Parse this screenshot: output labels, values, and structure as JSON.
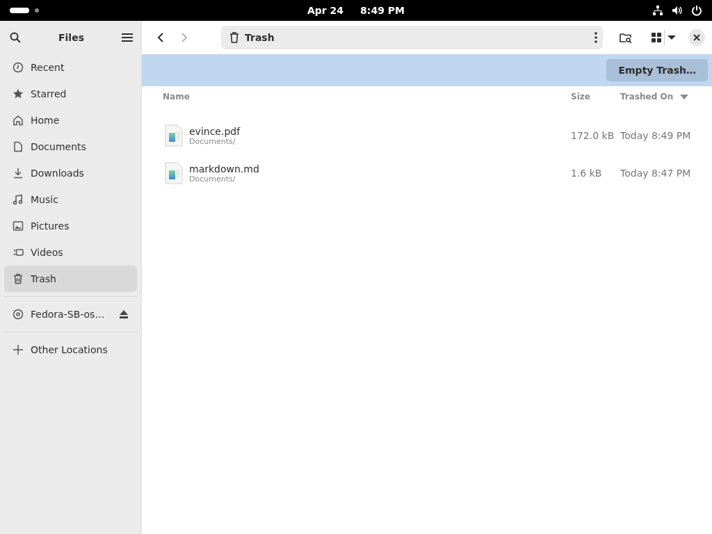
{
  "top_bar": {
    "date": "Apr 24",
    "time": "8:49 PM"
  },
  "sidebar": {
    "title": "Files",
    "places": [
      {
        "label": "Recent",
        "selected": false
      },
      {
        "label": "Starred",
        "selected": false
      },
      {
        "label": "Home",
        "selected": false
      },
      {
        "label": "Documents",
        "selected": false
      },
      {
        "label": "Downloads",
        "selected": false
      },
      {
        "label": "Music",
        "selected": false
      },
      {
        "label": "Pictures",
        "selected": false
      },
      {
        "label": "Videos",
        "selected": false
      },
      {
        "label": "Trash",
        "selected": true
      }
    ],
    "devices": [
      {
        "label": "Fedora-SB-os…",
        "selected": false
      }
    ],
    "other": [
      {
        "label": "Other Locations",
        "selected": false
      }
    ]
  },
  "toolbar": {
    "location": "Trash"
  },
  "banner": {
    "button": "Empty Trash…"
  },
  "table": {
    "columns": [
      {
        "label": "Name",
        "sorted": false
      },
      {
        "label": "Size",
        "sorted": false
      },
      {
        "label": "Trashed On",
        "sorted": true
      }
    ],
    "rows": [
      {
        "name": "evince.pdf",
        "location": "Documents/",
        "size": "172.0 kB",
        "trashed_on": "Today 8:49 PM"
      },
      {
        "name": "markdown.md",
        "location": "Documents/",
        "size": "1.6 kB",
        "trashed_on": "Today 8:47 PM"
      }
    ]
  }
}
